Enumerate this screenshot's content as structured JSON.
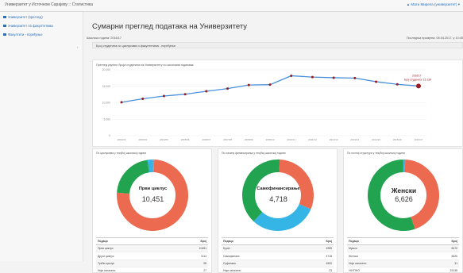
{
  "topbar": {
    "title": "Универзитет у Источном Сарајеву :: Статистика",
    "user": "▲ Мати Мирела (универзитет) ▾"
  },
  "sidebar": {
    "items": [
      {
        "label": "Универзитет (преглед)"
      },
      {
        "label": "Универзитет по факултетима"
      },
      {
        "label": "Факултети - поређење"
      }
    ]
  },
  "main": {
    "title": "Сумарни преглед података на Универзитету",
    "meta_left": "Школска година: 2016/17",
    "meta_right": "Последња промјена: 08.04.2017. у 10:45",
    "panel_label": "Број студената по циклусима и факултетима - поређење"
  },
  "colors": {
    "red": "#ec6a4f",
    "green": "#21a34f",
    "blue": "#34b5e6",
    "line": "#4a90d9",
    "marker": "#9a1c23"
  },
  "chart_data": {
    "type": "line",
    "title": "Преглед укупног броја студената на Универзитету по школским годинама",
    "x": [
      "2002/03",
      "2003/04",
      "2004/05",
      "2005/06",
      "2006/07",
      "2007/08",
      "2008/09",
      "2009/10",
      "2010/11",
      "2011/12",
      "2012/13",
      "2013/14",
      "2014/15",
      "2015/16",
      "2016/17"
    ],
    "y": [
      10150,
      11200,
      12050,
      12600,
      13500,
      14300,
      15400,
      15500,
      18200,
      17800,
      17600,
      17500,
      16400,
      15600,
      15100
    ],
    "ylim": [
      0,
      20000
    ],
    "yticks": [
      "0",
      "5.000",
      "10.000",
      "15.000",
      "20.000"
    ],
    "grid": true,
    "highlight_label_1": "2016/17",
    "highlight_label_2": "Број студената: 15.138"
  },
  "donuts": [
    {
      "header": "По циклусима у текућој школској години",
      "center_label": "Први циклус",
      "center_value": "10,451",
      "slices": [
        {
          "value": 10451,
          "color": "#ec6a4f"
        },
        {
          "value": 3000,
          "color": "#21a34f"
        },
        {
          "value": 340,
          "color": "#34b5e6"
        },
        {
          "value": 80,
          "color": "#7aa3c8"
        }
      ],
      "table": {
        "col_label": "Подаци",
        "col_value": "Број",
        "rows": [
          {
            "label": "Први циклус",
            "value": "10451"
          },
          {
            "label": "Други циклус",
            "value": "1114"
          },
          {
            "label": "Трећи циклус",
            "value": "98"
          },
          {
            "label": "Нији означено",
            "value": "27"
          }
        ]
      }
    },
    {
      "header": "По начину финансирања у текућој школској години",
      "center_label": "Самофинансирање",
      "center_value": "4,718",
      "slices": [
        {
          "value": 4718,
          "color": "#ec6a4f"
        },
        {
          "value": 4716,
          "color": "#34b5e6"
        },
        {
          "value": 6000,
          "color": "#21a34f"
        }
      ],
      "table": {
        "col_label": "Подаци",
        "col_value": "Број",
        "rows": [
          {
            "label": "Буџет",
            "value": "4985"
          },
          {
            "label": "Самофинанс.",
            "value": "4718"
          },
          {
            "label": "Суфинанс.",
            "value": "4500"
          },
          {
            "label": "Нији означено",
            "value": "23"
          }
        ]
      }
    },
    {
      "header": "По полној структури у текућој школској години",
      "center_label": "Женски",
      "center_value": "6,626",
      "slices": [
        {
          "value": 6626,
          "color": "#ec6a4f"
        },
        {
          "value": 8300,
          "color": "#21a34f"
        },
        {
          "value": 150,
          "color": "#34b5e6"
        }
      ],
      "table": {
        "col_label": "Подаци",
        "col_value": "Број",
        "rows": [
          {
            "label": "Мушки",
            "value": "8470"
          },
          {
            "label": "Женски",
            "value": "6626"
          },
          {
            "label": "Нији означено",
            "value": "31"
          },
          {
            "label": "УКУПНО",
            "value": "15138"
          }
        ]
      }
    }
  ]
}
